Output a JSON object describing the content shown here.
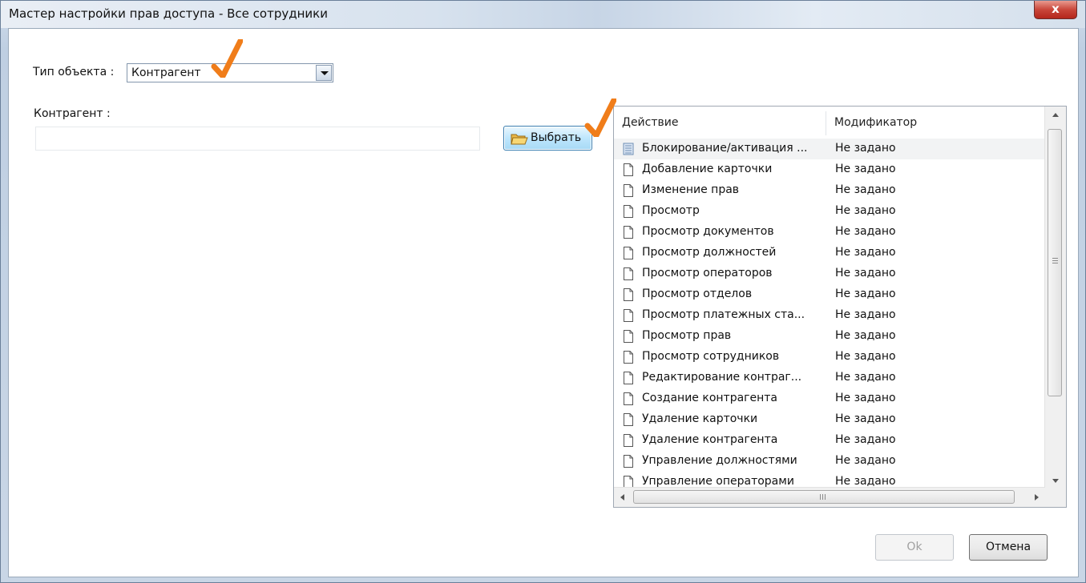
{
  "window": {
    "title": "Мастер настройки прав доступа - Все сотрудники",
    "close_label": "x"
  },
  "form": {
    "object_type_label": "Тип объекта :",
    "object_type_value": "Контрагент",
    "counterparty_label": "Контрагент :",
    "counterparty_value": "",
    "select_button_label": "Выбрать"
  },
  "grid": {
    "columns": [
      "Действие",
      "Модификатор"
    ],
    "rows": [
      {
        "action": "Блокирование/активация ...",
        "modifier": "Не задано",
        "selected": true
      },
      {
        "action": "Добавление карточки",
        "modifier": "Не задано"
      },
      {
        "action": "Изменение прав",
        "modifier": "Не задано"
      },
      {
        "action": "Просмотр",
        "modifier": "Не задано"
      },
      {
        "action": "Просмотр документов",
        "modifier": "Не задано"
      },
      {
        "action": "Просмотр должностей",
        "modifier": "Не задано"
      },
      {
        "action": "Просмотр операторов",
        "modifier": "Не задано"
      },
      {
        "action": "Просмотр отделов",
        "modifier": "Не задано"
      },
      {
        "action": "Просмотр платежных ста...",
        "modifier": "Не задано"
      },
      {
        "action": "Просмотр прав",
        "modifier": "Не задано"
      },
      {
        "action": "Просмотр сотрудников",
        "modifier": "Не задано"
      },
      {
        "action": "Редактирование контраг...",
        "modifier": "Не задано"
      },
      {
        "action": "Создание контрагента",
        "modifier": "Не задано"
      },
      {
        "action": "Удаление карточки",
        "modifier": "Не задано"
      },
      {
        "action": "Удаление контрагента",
        "modifier": "Не задано"
      },
      {
        "action": "Управление должностями",
        "modifier": "Не задано"
      },
      {
        "action": "Управление операторами",
        "modifier": "Не задано"
      }
    ]
  },
  "buttons": {
    "ok_label": "Ok",
    "ok_enabled": false,
    "cancel_label": "Отмена"
  },
  "colors": {
    "annotation_check": "#f07d1a",
    "title_close": "#c9463a",
    "accent_button": "#a7d9f5"
  }
}
